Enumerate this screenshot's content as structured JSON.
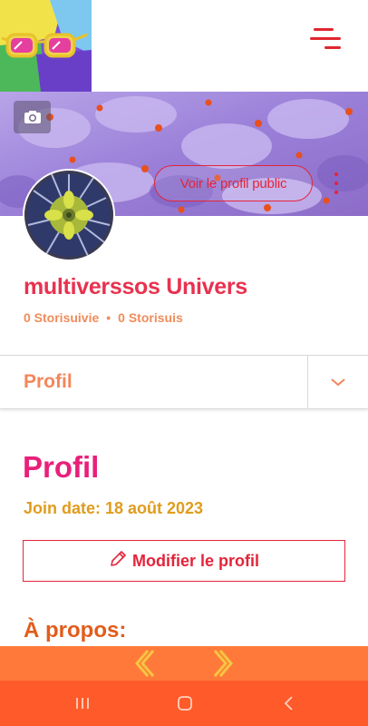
{
  "colors": {
    "accent_red": "#e4243a",
    "name_color": "#e8324f",
    "stats_color": "#f08c5a",
    "heading_pink": "#e8207a",
    "join_gold": "#e09c1c",
    "about_orange": "#e25c1a",
    "nav_orange": "#ff7a3a",
    "system_bar": "#ff5a2a"
  },
  "header": {
    "logo_icon": "sunglasses-logo-icon",
    "menu_icon": "hamburger-menu-icon"
  },
  "cover": {
    "camera_icon": "camera-icon",
    "public_profile_label": "Voir le profil public",
    "more_icon": "vertical-dots-icon"
  },
  "user": {
    "name": "multiverssos Univers",
    "followers": "0 Storisuivie",
    "separator": "•",
    "following": "0 Storisuis"
  },
  "section_select": {
    "selected": "Profil",
    "chevron_icon": "chevron-down-icon"
  },
  "profile": {
    "heading": "Profil",
    "join_date": "Join date: 18 août 2023",
    "edit_label": "Modifier le profil",
    "edit_icon": "pencil-icon",
    "about_heading": "À propos:"
  },
  "bottom_nav": {
    "prev_icon": "chevron-left-double-icon",
    "next_icon": "chevron-right-double-icon"
  },
  "system_bar": {
    "recents_icon": "recents-icon",
    "home_icon": "home-icon",
    "back_icon": "back-icon"
  }
}
